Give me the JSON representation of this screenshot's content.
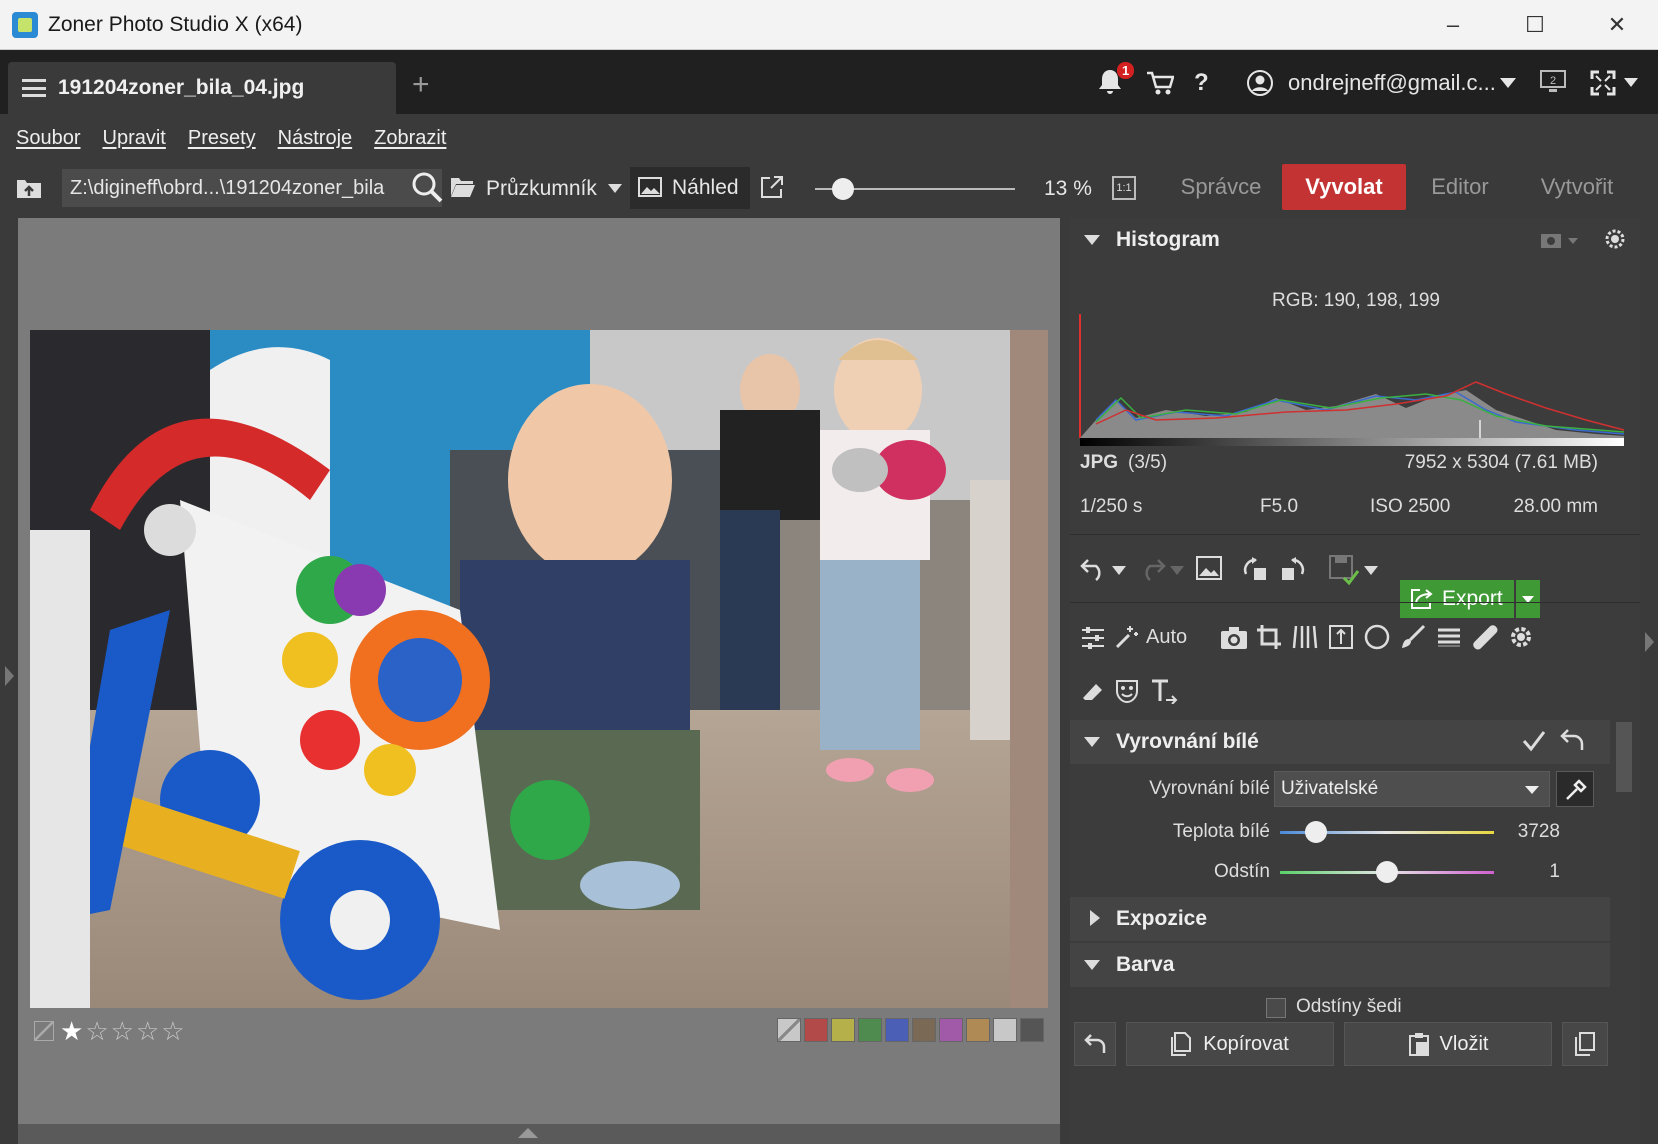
{
  "window": {
    "title": "Zoner Photo Studio X (x64)",
    "minimize_glyph": "–",
    "maximize_glyph": "☐",
    "close_glyph": "✕"
  },
  "tab": {
    "filename": "191204zoner_bila_04.jpg",
    "add_glyph": "+"
  },
  "top_right": {
    "notification_count": "1",
    "user_email": "ondrejneff@gmail.c...",
    "help": "?",
    "monitor_badge": "2"
  },
  "menu": [
    "Soubor",
    "Upravit",
    "Presety",
    "Nástroje",
    "Zobrazit"
  ],
  "toolbar": {
    "path": "Z:\\digineff\\obrd...\\191204zoner_bila",
    "browser_label": "Průzkumník",
    "preview_label": "Náhled",
    "zoom": "13 %",
    "one_to_one": "1:1",
    "zoom_level": 0.13
  },
  "modes": {
    "manager": "Správce",
    "develop": "Vyvolat",
    "editor": "Editor",
    "create": "Vytvořit"
  },
  "rating": {
    "stars": 1,
    "max": 5
  },
  "color_labels": [
    "#c8c8c8",
    "#b34a4a",
    "#b5b04a",
    "#4f8a4f",
    "#4a5fb5",
    "#7a6a55",
    "#a05aa8",
    "#b08a55",
    "#c8c8c8",
    "#555555"
  ],
  "histogram": {
    "title": "Histogram",
    "rgb": "RGB: 190, 198, 199"
  },
  "file_info": {
    "format": "JPG",
    "index": "(3/5)",
    "dimensions": "7952 x 5304 (7.61 MB)",
    "shutter": "1/250 s",
    "aperture": "F5.0",
    "iso": "ISO 2500",
    "focal": "28.00 mm"
  },
  "actions": {
    "export": "Export",
    "auto": "Auto"
  },
  "white_balance": {
    "section": "Vyrovnání bílé",
    "label": "Vyrovnání bílé",
    "preset": "Uživatelské",
    "temperature_label": "Teplota bílé",
    "temperature_value": "3728",
    "tint_label": "Odstín",
    "tint_value": "1"
  },
  "sections": {
    "exposure": "Expozice",
    "color": "Barva",
    "grayscale": "Odstíny šedi"
  },
  "footer": {
    "copy": "Kopírovat",
    "paste": "Vložit"
  }
}
